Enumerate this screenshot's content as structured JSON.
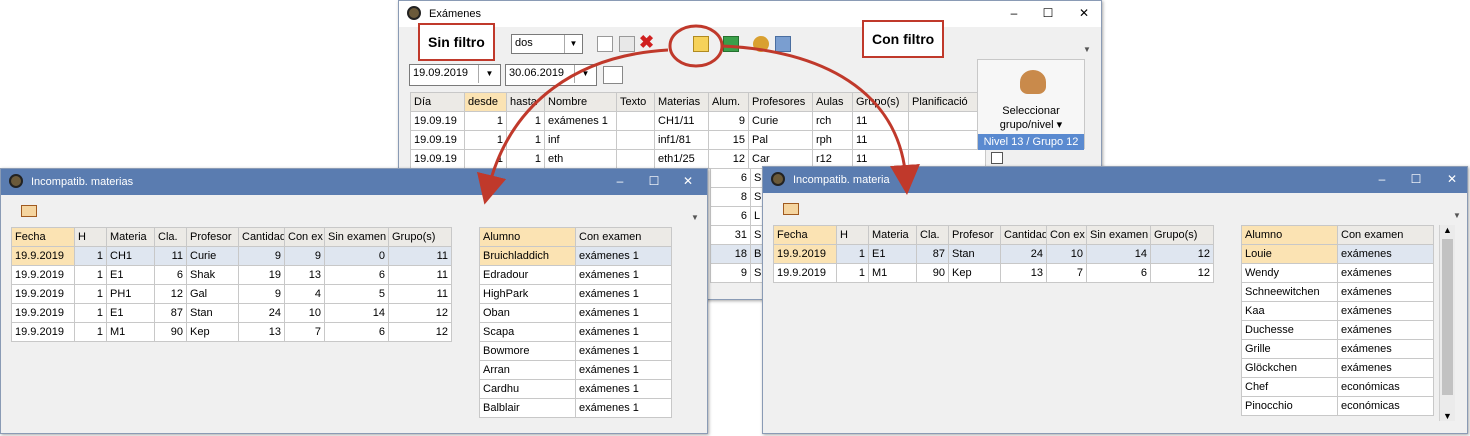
{
  "examenes": {
    "title": "Exámenes",
    "combo_value": "dos",
    "date_from": "19.09.2019",
    "date_to": "30.06.2019",
    "columns": [
      "Día",
      "desde",
      "hasta",
      "Nombre",
      "Texto",
      "Materias",
      "Alum.",
      "Profesores",
      "Aulas",
      "Grupo(s)",
      "Planificació"
    ],
    "rows": [
      [
        "19.09.19",
        "1",
        "1",
        "exámenes 1",
        "",
        "CH1/11",
        "9",
        "Curie",
        "rch",
        "11",
        ""
      ],
      [
        "19.09.19",
        "1",
        "1",
        "inf",
        "",
        "inf1/81",
        "15",
        "Pal",
        "rph",
        "11",
        ""
      ],
      [
        "19.09.19",
        "1",
        "1",
        "eth",
        "",
        "eth1/25",
        "12",
        "Car",
        "r12",
        "11",
        ""
      ]
    ],
    "hidden_rows": [
      {
        "alum": "6",
        "prof": "S"
      },
      {
        "alum": "8",
        "prof": "S"
      },
      {
        "alum": "6",
        "prof": "L"
      },
      {
        "alum": "31",
        "prof": "S"
      },
      {
        "alum": "18",
        "prof": "B"
      },
      {
        "alum": "9",
        "prof": "S"
      }
    ],
    "select_group": {
      "label1": "Seleccionar",
      "label2": "grupo/nivel",
      "value": "Nivel 13 / Grupo 12"
    }
  },
  "callouts": {
    "sin_filtro": "Sin filtro",
    "con_filtro": "Con filtro"
  },
  "left": {
    "title": "Incompatib. materias",
    "columns": [
      "Fecha",
      "H",
      "Materia",
      "Cla.",
      "Profesor",
      "Cantidad",
      "Con ex",
      "Sin examen",
      "Grupo(s)"
    ],
    "rows": [
      [
        "19.9.2019",
        "1",
        "CH1",
        "11",
        "Curie",
        "9",
        "9",
        "0",
        "11"
      ],
      [
        "19.9.2019",
        "1",
        "E1",
        "6",
        "Shak",
        "19",
        "13",
        "6",
        "11"
      ],
      [
        "19.9.2019",
        "1",
        "PH1",
        "12",
        "Gal",
        "9",
        "4",
        "5",
        "11"
      ],
      [
        "19.9.2019",
        "1",
        "E1",
        "87",
        "Stan",
        "24",
        "10",
        "14",
        "12"
      ],
      [
        "19.9.2019",
        "1",
        "M1",
        "90",
        "Kep",
        "13",
        "7",
        "6",
        "12"
      ]
    ],
    "students_columns": [
      "Alumno",
      "Con examen"
    ],
    "students": [
      [
        "Bruichladdich",
        "exámenes 1"
      ],
      [
        "Edradour",
        "exámenes 1"
      ],
      [
        "HighPark",
        "exámenes 1"
      ],
      [
        "Oban",
        "exámenes 1"
      ],
      [
        "Scapa",
        "exámenes 1"
      ],
      [
        "Bowmore",
        "exámenes 1"
      ],
      [
        "Arran",
        "exámenes 1"
      ],
      [
        "Cardhu",
        "exámenes 1"
      ],
      [
        "Balblair",
        "exámenes 1"
      ]
    ]
  },
  "right": {
    "title": "Incompatib. materia",
    "columns": [
      "Fecha",
      "H",
      "Materia",
      "Cla.",
      "Profesor",
      "Cantidad",
      "Con ex",
      "Sin examen",
      "Grupo(s)"
    ],
    "rows": [
      [
        "19.9.2019",
        "1",
        "E1",
        "87",
        "Stan",
        "24",
        "10",
        "14",
        "12"
      ],
      [
        "19.9.2019",
        "1",
        "M1",
        "90",
        "Kep",
        "13",
        "7",
        "6",
        "12"
      ]
    ],
    "students_columns": [
      "Alumno",
      "Con examen"
    ],
    "students": [
      [
        "Louie",
        "exámenes"
      ],
      [
        "Wendy",
        "exámenes"
      ],
      [
        "Schneewitchen",
        "exámenes"
      ],
      [
        "Kaa",
        "exámenes"
      ],
      [
        "Duchesse",
        "exámenes"
      ],
      [
        "Grille",
        "exámenes"
      ],
      [
        "Glöckchen",
        "exámenes"
      ],
      [
        "Chef",
        "económicas"
      ],
      [
        "Pinocchio",
        "económicas"
      ]
    ]
  },
  "colors": {
    "accent": "#c0392b",
    "titlebar": "#5a7cb0",
    "highlight": "#fbe3b3",
    "group_bar": "#5a8ad0"
  },
  "icons": [
    "window-app-icon",
    "minimize-icon",
    "maximize-icon",
    "close-icon",
    "new-icon",
    "copy-icon",
    "delete-icon",
    "filter-icon",
    "add-icon",
    "settings-icon",
    "print-icon",
    "calendar-icon",
    "grid-icon",
    "select-group-icon"
  ]
}
